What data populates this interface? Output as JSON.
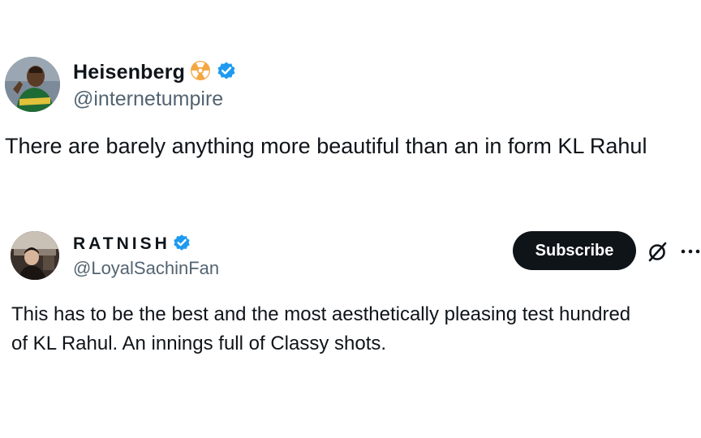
{
  "tweets": [
    {
      "display_name": "Heisenberg",
      "handle": "@internetumpire",
      "text": "There are barely anything more beautiful than an in form KL Rahul",
      "avatar_icon": "cricketer-avatar",
      "badges": [
        "radiation-icon",
        "verified-badge-icon"
      ]
    },
    {
      "display_name": "RATNISH",
      "handle": "@LoyalSachinFan",
      "text_lines": [
        "This has to be the best and the most aesthetically pleasing test hundred",
        "of KL Rahul. An innings full of Classy shots."
      ],
      "avatar_icon": "portrait-avatar",
      "badges": [
        "verified-badge-icon"
      ],
      "subscribe_label": "Subscribe",
      "actions": [
        "grok-icon",
        "more-options-icon"
      ]
    }
  ],
  "colors": {
    "verified_blue": "#1d9bf0",
    "radiation_orange": "#f4a742",
    "handle_gray": "#536471",
    "button_black": "#0f1419"
  }
}
